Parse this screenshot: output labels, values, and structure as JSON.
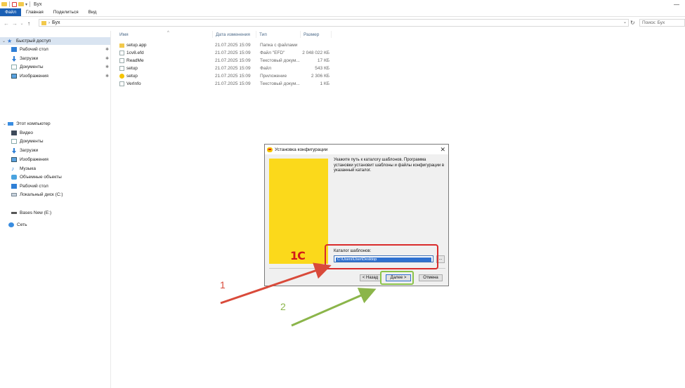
{
  "window": {
    "title": "Бух",
    "minimize": "—"
  },
  "ribbon": {
    "tabs": [
      "Файл",
      "Главная",
      "Поделиться",
      "Вид"
    ]
  },
  "address": {
    "crumb_sep": "›",
    "path": "Бух",
    "dropdown": "⌄",
    "refresh": "↻",
    "search_placeholder": "Поиск: Бух"
  },
  "nav_arrows": {
    "back": "←",
    "forward": "→",
    "recent": "⌄",
    "up": "↑"
  },
  "sidebar": {
    "quick_access": "Быстрый доступ",
    "pinned": [
      {
        "label": "Рабочий стол",
        "icon": "desktop-icon"
      },
      {
        "label": "Загрузки",
        "icon": "downloads-icon"
      },
      {
        "label": "Документы",
        "icon": "documents-icon"
      },
      {
        "label": "Изображения",
        "icon": "pictures-icon"
      }
    ],
    "pin_glyph": "✱",
    "this_pc": "Этот компьютер",
    "pc_items": [
      {
        "label": "Видео",
        "icon": "video-icon"
      },
      {
        "label": "Документы",
        "icon": "documents-icon"
      },
      {
        "label": "Загрузки",
        "icon": "downloads-icon"
      },
      {
        "label": "Изображения",
        "icon": "pictures-icon"
      },
      {
        "label": "Музыка",
        "icon": "music-icon"
      },
      {
        "label": "Объемные объекты",
        "icon": "3d-objects-icon"
      },
      {
        "label": "Рабочий стол",
        "icon": "desktop-icon"
      },
      {
        "label": "Локальный диск (C:)",
        "icon": "disk-icon"
      }
    ],
    "usb": "Bases New (E:)",
    "network": "Сеть"
  },
  "columns": {
    "name": "Имя",
    "date": "Дата изменения",
    "type": "Тип",
    "size": "Размер",
    "sort_indicator": "^"
  },
  "files": [
    {
      "name": "setup.app",
      "date": "21.07.2025 15:09",
      "type": "Папка с файлами",
      "size": "",
      "icon": "folder-icon"
    },
    {
      "name": "1cv8.efd",
      "date": "21.07.2025 15:09",
      "type": "Файл \"EFD\"",
      "size": "2 048 022 КБ",
      "icon": "file-icon"
    },
    {
      "name": "ReadMe",
      "date": "21.07.2025 15:09",
      "type": "Текстовый докум...",
      "size": "17 КБ",
      "icon": "file-icon"
    },
    {
      "name": "setup",
      "date": "21.07.2025 15:09",
      "type": "Файл",
      "size": "543 КБ",
      "icon": "file-icon"
    },
    {
      "name": "setup",
      "date": "21.07.2025 15:09",
      "type": "Приложение",
      "size": "2 306 КБ",
      "icon": "app-icon"
    },
    {
      "name": "VerInfo",
      "date": "21.07.2025 15:09",
      "type": "Текстовый докум...",
      "size": "1 КБ",
      "icon": "file-icon"
    }
  ],
  "dialog": {
    "title": "Установка конфигурации",
    "close": "✕",
    "description": "Укажите путь к каталогу шаблонов. Программа установки установит шаблоны и файлы конфигурации в указанный каталог.",
    "brand": "1С",
    "catalog_label": "Каталог шаблонов:",
    "catalog_value": "C:\\Users\\User\\Desktop",
    "browse": "...",
    "back_button": "< Назад",
    "next_button": "Далее >",
    "cancel_button": "Отмена"
  },
  "annotations": {
    "step1": "1",
    "step2": "2",
    "step1_color": "#d94a3a",
    "step2_color": "#8bb54a"
  },
  "colors": {
    "file_tab": "#1a5fb4",
    "selected_nav": "#d9e4f1",
    "banner_yellow": "#fbd91b",
    "brand_red": "#d21a1a"
  }
}
